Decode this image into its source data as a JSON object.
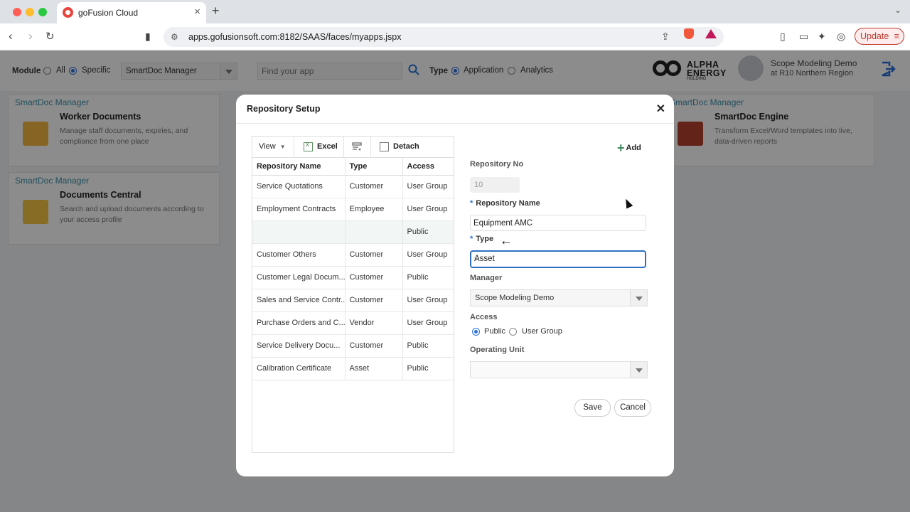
{
  "browser": {
    "tab_title": "goFusion Cloud",
    "url": "apps.gofusionsoft.com:8182/SAAS/faces/myapps.jspx",
    "update_label": "Update"
  },
  "filters": {
    "module_label": "Module",
    "all_label": "All",
    "specific_label": "Specific",
    "module_selected": "SmartDoc Manager",
    "search_placeholder": "Find your app",
    "type_label": "Type",
    "application_label": "Application",
    "analytics_label": "Analytics"
  },
  "company": {
    "line1": "ALPHA",
    "line2": "ENERGY",
    "line3": "HOLDING"
  },
  "user": {
    "name": "Scope Modeling Demo",
    "region": "at R10 Northern Region"
  },
  "cards": [
    {
      "module": "SmartDoc Manager",
      "name": "Worker Documents",
      "desc": "Manage staff documents, expiries, and compliance from one place"
    },
    {
      "module": "SmartDoc Manager",
      "name": "Documents Central",
      "desc": "Search and upload documents according to your access profile"
    },
    {
      "module": "SmartDoc Manager",
      "name": "SmartDoc Engine",
      "desc": "Transform Excel/Word templates into live, data-driven reports"
    }
  ],
  "modal": {
    "title": "Repository Setup",
    "toolbar": {
      "view": "View",
      "excel": "Excel",
      "detach": "Detach"
    },
    "columns": [
      "Repository Name",
      "Type",
      "Access"
    ],
    "rows": [
      [
        "Service Quotations",
        "Customer",
        "User Group"
      ],
      [
        "Employment Contracts",
        "Employee",
        "User Group"
      ],
      [
        "",
        "",
        "Public"
      ],
      [
        "Customer Others",
        "Customer",
        "User Group"
      ],
      [
        "Customer Legal Docum...",
        "Customer",
        "Public"
      ],
      [
        "Sales and Service Contr...",
        "Customer",
        "User Group"
      ],
      [
        "Purchase Orders and C...",
        "Vendor",
        "User Group"
      ],
      [
        "Service Delivery Docu...",
        "Customer",
        "Public"
      ],
      [
        "Calibration Certificate",
        "Asset",
        "Public"
      ]
    ],
    "form": {
      "add_label": "Add",
      "repo_no_label": "Repository No",
      "repo_no_value": "10",
      "repo_name_label": "Repository Name",
      "repo_name_value": "Equipment AMC",
      "type_label": "Type",
      "type_value": "Asset",
      "manager_label": "Manager",
      "manager_value": "Scope Modeling Demo",
      "access_label": "Access",
      "access_public": "Public",
      "access_usergroup": "User Group",
      "operating_unit_label": "Operating Unit",
      "operating_unit_value": "",
      "required_mark": "*"
    },
    "save_label": "Save",
    "cancel_label": "Cancel"
  }
}
